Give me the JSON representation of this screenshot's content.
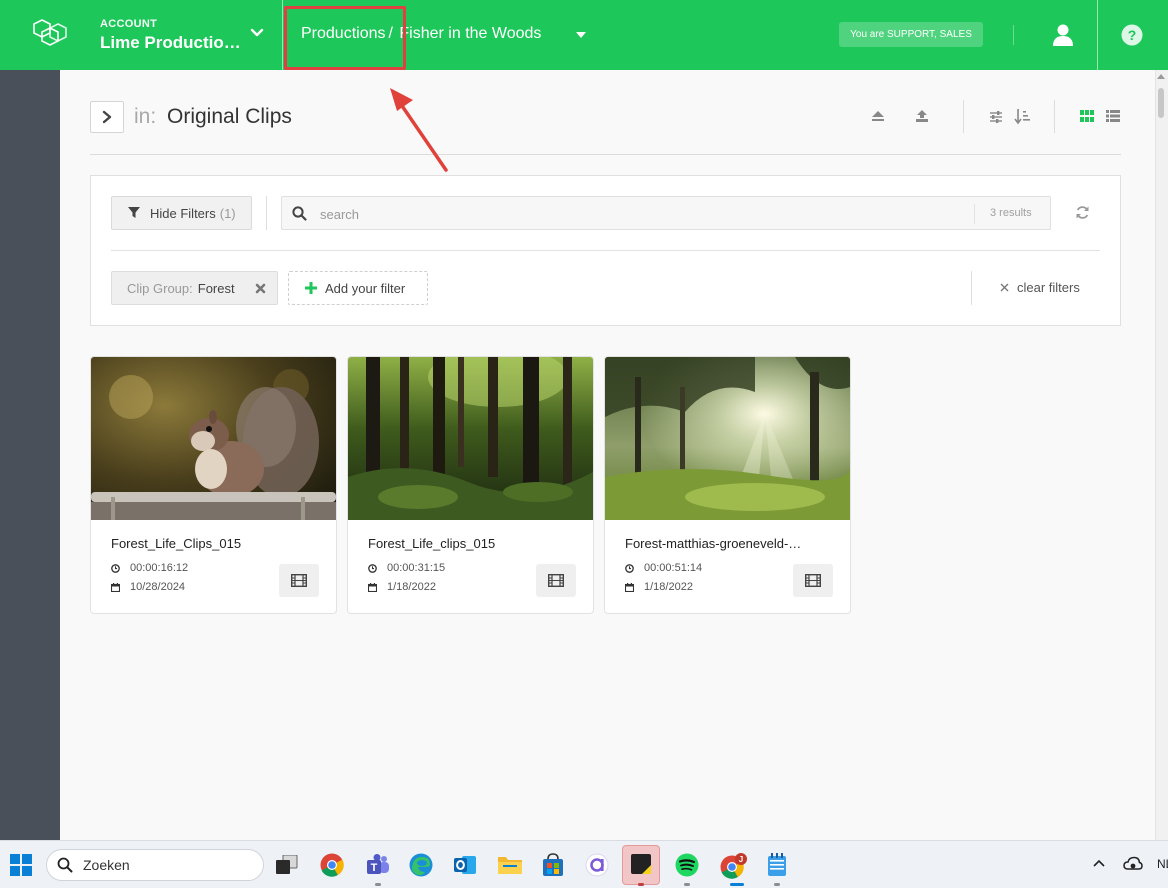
{
  "topbar": {
    "account_label": "ACCOUNT",
    "account_name": "Lime Productio…",
    "breadcrumb_root": "Productions",
    "breadcrumb_sep": "/",
    "breadcrumb_current": "Fisher in the Woods",
    "role_badge": "You are SUPPORT, SALES",
    "brand_color": "#1ec75a"
  },
  "toolbar": {
    "in_label": "in:",
    "folder_title": "Original Clips",
    "icons": [
      "eject-icon",
      "upload-icon",
      "sliders-icon",
      "sort-icon",
      "grid-view-icon",
      "list-view-icon"
    ]
  },
  "filters": {
    "hide_label": "Hide Filters",
    "hide_count": "(1)",
    "search_placeholder": "search",
    "search_value": "",
    "results": "3 results",
    "chip_key": "Clip Group:",
    "chip_value": "Forest",
    "add_label": "Add your filter",
    "clear_label": "clear filters"
  },
  "clips": [
    {
      "title": "Forest_Life_Clips_015",
      "duration": "00:00:16:12",
      "date": "10/28/2024"
    },
    {
      "title": "Forest_Life_clips_015",
      "duration": "00:00:31:15",
      "date": "1/18/2022"
    },
    {
      "title": "Forest-matthias-groeneveld-…",
      "duration": "00:00:51:14",
      "date": "1/18/2022"
    }
  ],
  "taskbar": {
    "search_label": "Zoeken",
    "tray_lang": "NL",
    "apps": [
      "windows-start-icon",
      "search-icon",
      "task-view-icon",
      "chrome-icon",
      "teams-icon",
      "edge-icon",
      "outlook-icon",
      "file-explorer-icon",
      "store-icon",
      "app-a-icon",
      "notes-icon",
      "spotify-icon",
      "chrome-profile-icon",
      "notepad-icon"
    ]
  }
}
